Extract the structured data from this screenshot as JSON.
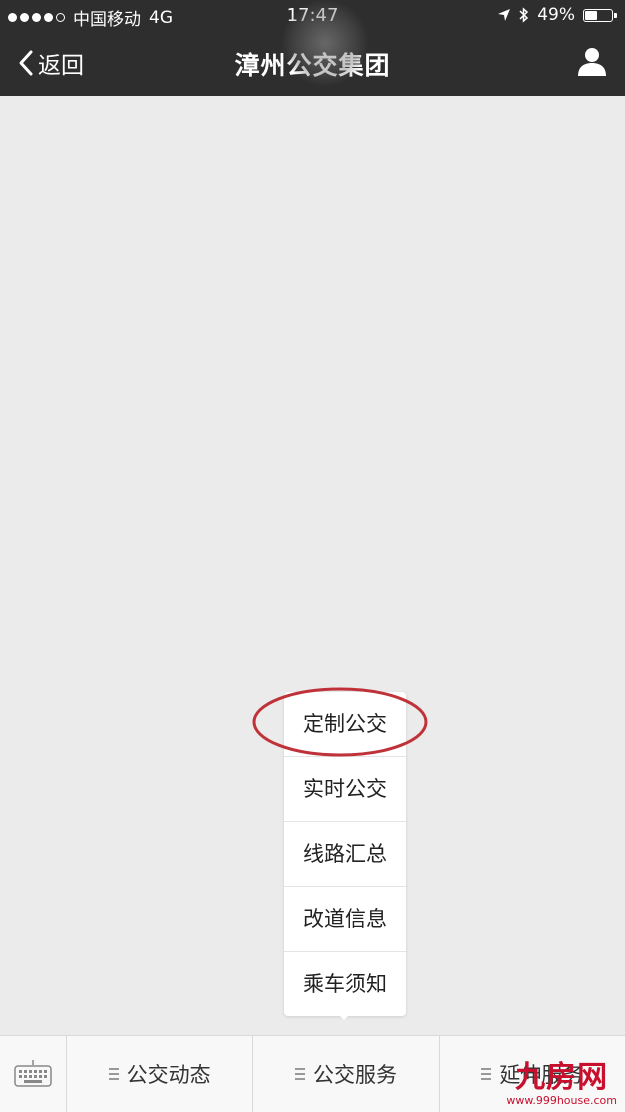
{
  "status_bar": {
    "carrier": "中国移动",
    "network": "4G",
    "time": "17:47",
    "bluetooth": "✱",
    "battery_percent": "49%",
    "battery_level": 0.49
  },
  "nav": {
    "back_label": "返回",
    "title": "漳州公交集团"
  },
  "submenu": {
    "items": [
      {
        "label": "定制公交"
      },
      {
        "label": "实时公交"
      },
      {
        "label": "线路汇总"
      },
      {
        "label": "改道信息"
      },
      {
        "label": "乘车须知"
      }
    ],
    "highlighted_index": 0,
    "highlight_color": "#c0323a"
  },
  "bottom_menu": {
    "tabs": [
      {
        "label": "公交动态"
      },
      {
        "label": "公交服务"
      },
      {
        "label": "延伸服务"
      }
    ]
  },
  "watermark": {
    "logo": "九房网",
    "url": "www.999house.com"
  },
  "colors": {
    "header_bg": "#2e2e2e",
    "content_bg": "#ebebeb",
    "watermark": "#c8102e"
  }
}
